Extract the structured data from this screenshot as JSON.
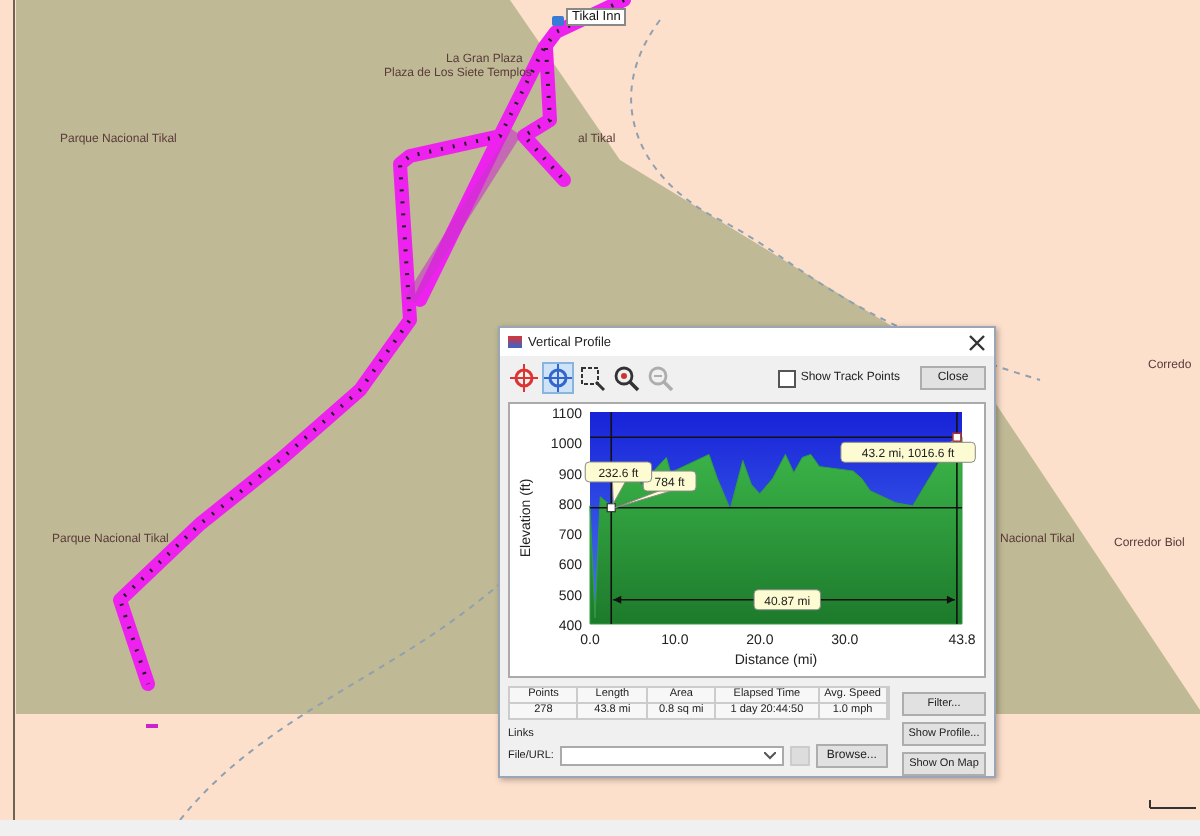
{
  "map": {
    "labels": [
      {
        "text": "Tikal Inn",
        "kind": "poi"
      },
      {
        "text": "La Gran Plaza",
        "kind": "place"
      },
      {
        "text": "Plaza de Los Siete Templos",
        "kind": "place"
      },
      {
        "text": "Parque Nacional Tikal",
        "kind": "place"
      },
      {
        "text": "al Tikal",
        "kind": "place"
      },
      {
        "text": "Parque Nacional Tikal",
        "kind": "place"
      },
      {
        "text": "Nacional Tikal",
        "kind": "place"
      },
      {
        "text": "Corredor Biol",
        "kind": "place"
      },
      {
        "text": "Corredo",
        "kind": "place"
      }
    ]
  },
  "dialog": {
    "title": "Vertical Profile",
    "tools": [
      {
        "kind": "crosshair",
        "selected": false,
        "disabled": false
      },
      {
        "kind": "pan",
        "selected": true,
        "disabled": false
      },
      {
        "kind": "zoom-box",
        "selected": false,
        "disabled": false
      },
      {
        "kind": "zoom-in",
        "selected": false,
        "disabled": false
      },
      {
        "kind": "zoom-out",
        "selected": false,
        "disabled": true
      }
    ],
    "show_track_points": {
      "label": "Show Track Points",
      "checked": false
    },
    "close_button": "Close",
    "chart_data": {
      "type": "area",
      "xlabel": "Distance  (mi)",
      "ylabel": "Elevation (ft)",
      "x": [
        0,
        0.6,
        1.2,
        2.5,
        4,
        5,
        6,
        9,
        9.5,
        14,
        15,
        16.5,
        18,
        19,
        20,
        21.5,
        23,
        24,
        25,
        26,
        27,
        31,
        32,
        33,
        34.5,
        36,
        38,
        39.5,
        41,
        43.2,
        43.8
      ],
      "values": [
        790,
        420,
        820,
        790,
        860,
        930,
        860,
        950,
        900,
        960,
        880,
        780,
        940,
        860,
        830,
        880,
        960,
        900,
        950,
        960,
        920,
        905,
        880,
        840,
        820,
        800,
        790,
        860,
        930,
        1016,
        1016
      ],
      "xlim": [
        0,
        43.8
      ],
      "ylim": [
        400,
        1100
      ],
      "xticks": [
        {
          "value": 0,
          "label": "0.0"
        },
        {
          "value": 10,
          "label": "10.0"
        },
        {
          "value": 20,
          "label": "20.0"
        },
        {
          "value": 30,
          "label": "30.0"
        },
        {
          "value": 43.8,
          "label": "43.8"
        }
      ],
      "yticks": [
        400,
        500,
        600,
        700,
        800,
        900,
        1000,
        1100
      ],
      "annotations": [
        {
          "text": "784 ft"
        },
        {
          "text": "232.6 ft"
        },
        {
          "text": "43.2 mi, 1016.6 ft"
        },
        {
          "text": "40.87 mi"
        }
      ]
    },
    "stats": {
      "columns": [
        "Points",
        "Length",
        "Area",
        "Elapsed Time",
        "Avg. Speed"
      ],
      "values": [
        "278",
        "43.8 mi",
        "0.8 sq mi",
        "1 day 20:44:50",
        "1.0 mph"
      ]
    },
    "links": {
      "title": "Links",
      "field_label": "File/URL:",
      "browse_button": "Browse..."
    },
    "side_buttons": [
      "Filter...",
      "Show Profile...",
      "Show On Map"
    ]
  }
}
